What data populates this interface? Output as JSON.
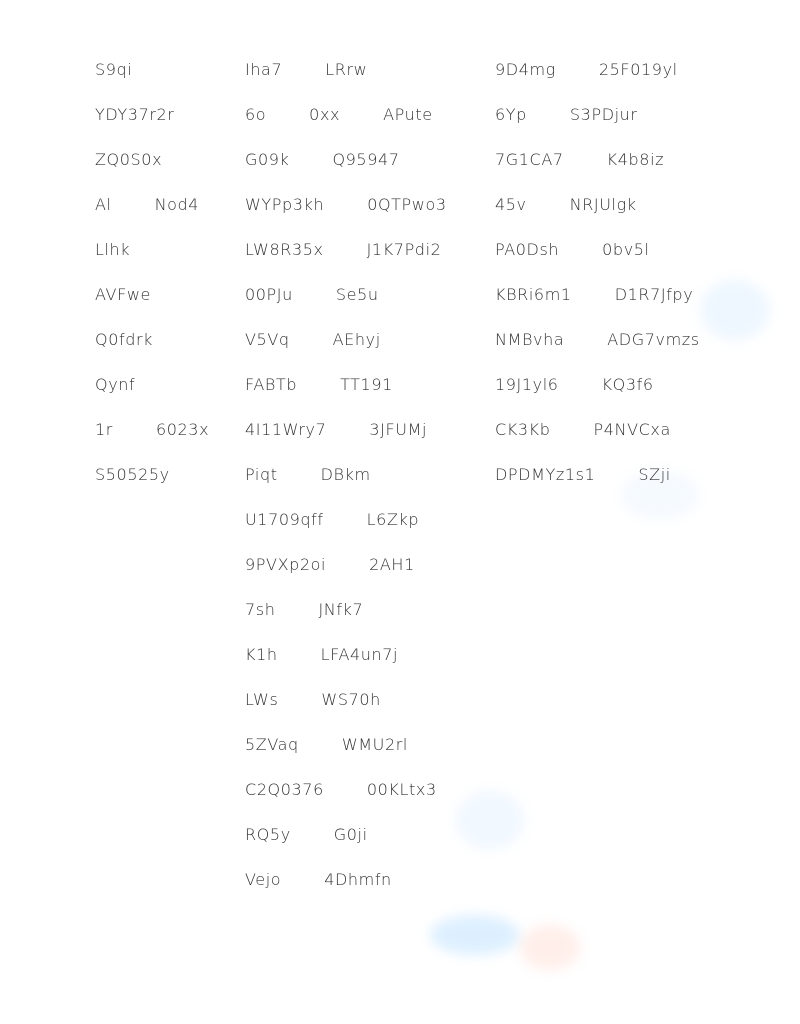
{
  "columns": [
    {
      "rows": [
        [
          "S9qi"
        ],
        [
          "YDY37r2r"
        ],
        [
          "ZQ0S0x"
        ],
        [
          "Al",
          "Nod4"
        ],
        [
          "Llhk"
        ],
        [
          "AVFwe"
        ],
        [
          "Q0fdrk"
        ],
        [
          "Qynf"
        ],
        [
          "1r",
          "6023x"
        ],
        [
          "S50525y"
        ]
      ]
    },
    {
      "rows": [
        [
          "Iha7",
          "LRrw"
        ],
        [
          "6o",
          "0xx",
          "APute"
        ],
        [
          "G09k",
          "Q95947"
        ],
        [
          "WYPp3kh",
          "0QTPwo3"
        ],
        [
          "LW8R35x",
          "J1K7Pdi2"
        ],
        [
          "00PJu",
          "Se5u"
        ],
        [
          "V5Vq",
          "AEhyj"
        ],
        [
          "FABTb",
          "TT191"
        ],
        [
          "4I11Wry7",
          "3JFUMj"
        ],
        [
          "Piqt",
          "DBkm"
        ],
        [
          "U1709qff",
          "L6Zkp"
        ],
        [
          "9PVXp2oi",
          "2AH1"
        ],
        [
          "7sh",
          "JNfk7"
        ],
        [
          "K1h",
          "LFA4un7j"
        ],
        [
          "LWs",
          "WS70h"
        ],
        [
          "5ZVaq",
          "WMU2rl"
        ],
        [
          "C2Q0376",
          "00KLtx3"
        ],
        [
          "RQ5y",
          "G0ji"
        ],
        [
          "Vejo",
          "4Dhmfn"
        ]
      ]
    },
    {
      "rows": [
        [
          "9D4mg",
          "25F019yl"
        ],
        [
          "6Yp",
          "S3PDjur"
        ],
        [
          "7G1CA7",
          "K4b8iz"
        ],
        [
          "45v",
          "NRJUlgk"
        ],
        [
          "PA0Dsh",
          "0bv5l"
        ],
        [
          "KBRi6m1",
          "D1R7Jfpy"
        ],
        [
          "NMBvha",
          "ADG7vmzs"
        ],
        [
          "19J1yl6",
          "KQ3f6"
        ],
        [
          "CK3Kb",
          "P4NVCxa"
        ],
        [
          "DPDMYz1s1",
          "SZji"
        ]
      ]
    }
  ]
}
